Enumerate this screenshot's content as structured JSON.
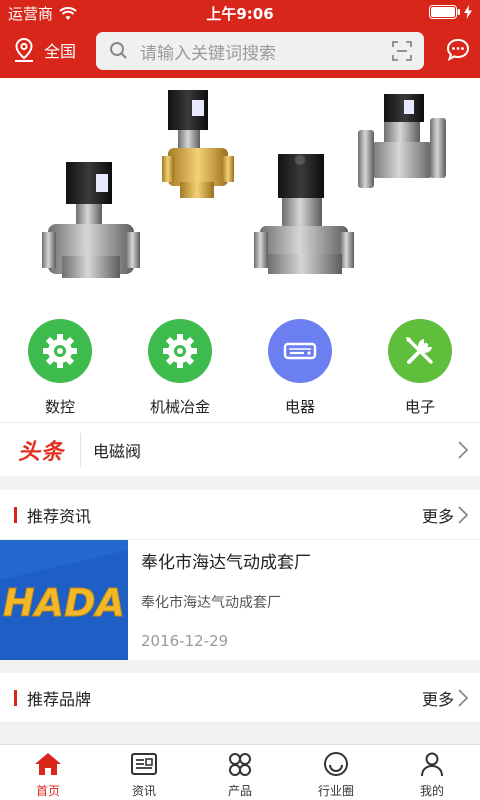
{
  "status": {
    "carrier": "运营商",
    "time": "上午9:06"
  },
  "header": {
    "location": "全国",
    "search_placeholder": "请输入关键词搜索"
  },
  "categories": [
    {
      "label": "数控",
      "color": "#3dbb4d",
      "icon": "gear-icon"
    },
    {
      "label": "机械冶金",
      "color": "#3dbb4d",
      "icon": "gear-icon"
    },
    {
      "label": "电器",
      "color": "#6b7ff0",
      "icon": "router-icon"
    },
    {
      "label": "电子",
      "color": "#5fbf3d",
      "icon": "tools-icon"
    }
  ],
  "headline": {
    "tag": "头条",
    "text": "电磁阀"
  },
  "news_section": {
    "title": "推荐资讯",
    "more": "更多"
  },
  "news_item": {
    "title": "奉化市海达气动成套厂",
    "subtitle": "奉化市海达气动成套厂",
    "date": "2016-12-29",
    "logo_text": "HADA"
  },
  "brand_section": {
    "title": "推荐品牌",
    "more": "更多"
  },
  "tabs": [
    {
      "label": "首页",
      "icon": "home-icon",
      "active": true
    },
    {
      "label": "资讯",
      "icon": "news-icon",
      "active": false
    },
    {
      "label": "产品",
      "icon": "grid-icon",
      "active": false
    },
    {
      "label": "行业圈",
      "icon": "smile-icon",
      "active": false
    },
    {
      "label": "我的",
      "icon": "user-icon",
      "active": false
    }
  ]
}
